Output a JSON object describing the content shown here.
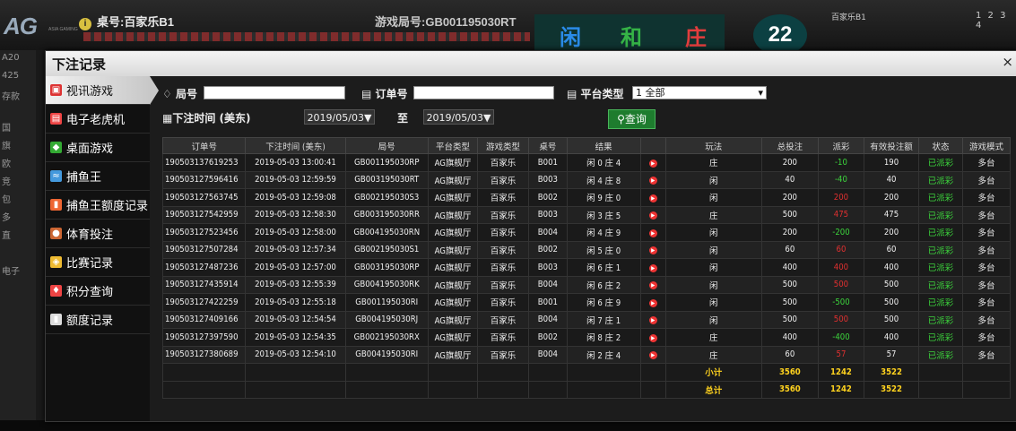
{
  "background": {
    "logo_ag": "AG",
    "logo_sub": "ASIA GAMING",
    "table_label": "桌号:百家乐B1",
    "round_label": "游戏局号:GB001195030RT",
    "round_blocks": [
      "闲",
      "和",
      "庄"
    ],
    "countdown": "22",
    "room_label": "百家乐B1",
    "top_right_digits": "1 2 3 4",
    "left_labels": [
      "A20",
      "425",
      "存款",
      "国",
      "旗",
      "欧",
      "竞",
      "包",
      "多",
      "直",
      "",
      "电子"
    ]
  },
  "dialog": {
    "title": "下注记录",
    "close": "×"
  },
  "sidebar": [
    {
      "label": "视讯游戏",
      "icon": "video-game-icon",
      "glyph": "▣",
      "color": "#d33"
    },
    {
      "label": "电子老虎机",
      "icon": "slot-machine-icon",
      "glyph": "▤",
      "color": "#e44"
    },
    {
      "label": "桌面游戏",
      "icon": "table-game-icon",
      "glyph": "◆",
      "color": "#3a3"
    },
    {
      "label": "捕鱼王",
      "icon": "fish-icon",
      "glyph": "≈",
      "color": "#49d"
    },
    {
      "label": "捕鱼王额度记录",
      "icon": "record-icon",
      "glyph": "▮",
      "color": "#e63"
    },
    {
      "label": "体育投注",
      "icon": "sport-icon",
      "glyph": "●",
      "color": "#c63"
    },
    {
      "label": "比赛记录",
      "icon": "match-icon",
      "glyph": "◈",
      "color": "#eb3"
    },
    {
      "label": "积分查询",
      "icon": "points-icon",
      "glyph": "♦",
      "color": "#e44"
    },
    {
      "label": "额度记录",
      "icon": "credit-icon",
      "glyph": "▮",
      "color": "#ddd"
    }
  ],
  "filters": {
    "table_label": "局号",
    "table_value": "",
    "order_label": "订单号",
    "order_value": "",
    "platform_label": "平台类型",
    "platform_value": "1 全部",
    "time_label": "下注时间 (美东)",
    "date_from": "2019/05/03▼",
    "to_label": "至",
    "date_to": "2019/05/03▼",
    "query_label": "查询"
  },
  "table": {
    "headers": [
      "订单号",
      "下注时间 (美东)",
      "局号",
      "平台类型",
      "游戏类型",
      "桌号",
      "结果",
      "",
      "玩法",
      "总投注",
      "派彩",
      "有效投注额",
      "状态",
      "游戏模式"
    ],
    "rows": [
      [
        "190503137619253",
        "2019-05-03 13:00:41",
        "GB001195030RP",
        "AG旗舰厅",
        "百家乐",
        "B001",
        "闲 0 庄 4",
        "庄",
        "200",
        "-10",
        "190",
        "已派彩",
        "多台",
        "neg"
      ],
      [
        "190503127596416",
        "2019-05-03 12:59:59",
        "GB003195030RT",
        "AG旗舰厅",
        "百家乐",
        "B003",
        "闲 4 庄 8",
        "闲",
        "40",
        "-40",
        "40",
        "已派彩",
        "多台",
        "neg"
      ],
      [
        "190503127563745",
        "2019-05-03 12:59:08",
        "GB002195030S3",
        "AG旗舰厅",
        "百家乐",
        "B002",
        "闲 9 庄 0",
        "闲",
        "200",
        "200",
        "200",
        "已派彩",
        "多台",
        "pos"
      ],
      [
        "190503127542959",
        "2019-05-03 12:58:30",
        "GB003195030RR",
        "AG旗舰厅",
        "百家乐",
        "B003",
        "闲 3 庄 5",
        "庄",
        "500",
        "475",
        "475",
        "已派彩",
        "多台",
        "pos"
      ],
      [
        "190503127523456",
        "2019-05-03 12:58:00",
        "GB004195030RN",
        "AG旗舰厅",
        "百家乐",
        "B004",
        "闲 4 庄 9",
        "闲",
        "200",
        "-200",
        "200",
        "已派彩",
        "多台",
        "neg"
      ],
      [
        "190503127507284",
        "2019-05-03 12:57:34",
        "GB002195030S1",
        "AG旗舰厅",
        "百家乐",
        "B002",
        "闲 5 庄 0",
        "闲",
        "60",
        "60",
        "60",
        "已派彩",
        "多台",
        "pos"
      ],
      [
        "190503127487236",
        "2019-05-03 12:57:00",
        "GB003195030RP",
        "AG旗舰厅",
        "百家乐",
        "B003",
        "闲 6 庄 1",
        "闲",
        "400",
        "400",
        "400",
        "已派彩",
        "多台",
        "pos"
      ],
      [
        "190503127435914",
        "2019-05-03 12:55:39",
        "GB004195030RK",
        "AG旗舰厅",
        "百家乐",
        "B004",
        "闲 6 庄 2",
        "闲",
        "500",
        "500",
        "500",
        "已派彩",
        "多台",
        "pos"
      ],
      [
        "190503127422259",
        "2019-05-03 12:55:18",
        "GB001195030RI",
        "AG旗舰厅",
        "百家乐",
        "B001",
        "闲 6 庄 9",
        "闲",
        "500",
        "-500",
        "500",
        "已派彩",
        "多台",
        "neg"
      ],
      [
        "190503127409166",
        "2019-05-03 12:54:54",
        "GB004195030RJ",
        "AG旗舰厅",
        "百家乐",
        "B004",
        "闲 7 庄 1",
        "闲",
        "500",
        "500",
        "500",
        "已派彩",
        "多台",
        "pos"
      ],
      [
        "190503127397590",
        "2019-05-03 12:54:35",
        "GB002195030RX",
        "AG旗舰厅",
        "百家乐",
        "B002",
        "闲 8 庄 2",
        "庄",
        "400",
        "-400",
        "400",
        "已派彩",
        "多台",
        "neg"
      ],
      [
        "190503127380689",
        "2019-05-03 12:54:10",
        "GB004195030RI",
        "AG旗舰厅",
        "百家乐",
        "B004",
        "闲 2 庄 4",
        "庄",
        "60",
        "57",
        "57",
        "已派彩",
        "多台",
        "pos"
      ]
    ],
    "subtotal": {
      "label": "小计",
      "total_bet": "3560",
      "payout": "1242",
      "valid_bet": "3522"
    },
    "total": {
      "label": "总计",
      "total_bet": "3560",
      "payout": "1242",
      "valid_bet": "3522"
    }
  }
}
